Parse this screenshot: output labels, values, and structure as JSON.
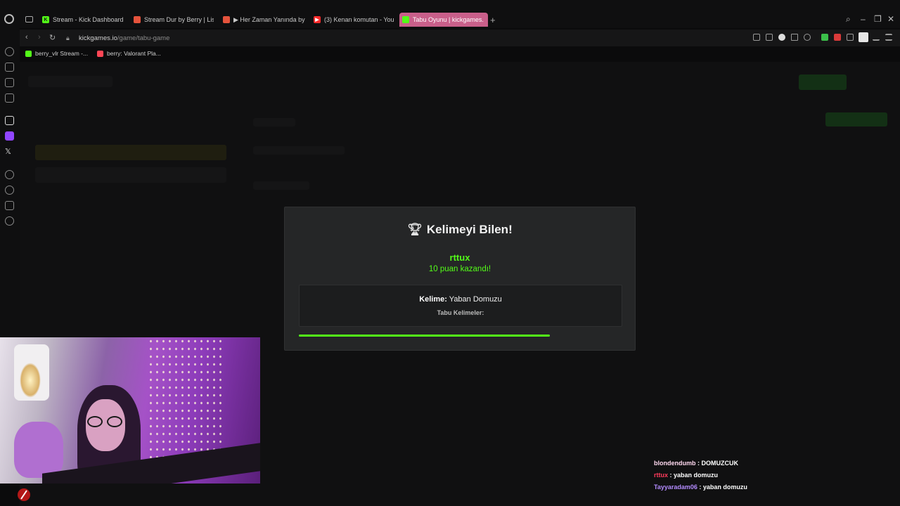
{
  "browser": {
    "tabs": [
      {
        "label": "Stream - Kick Dashboard",
        "favicon_color": "#53fc18",
        "favicon_glyph": "K",
        "active": false
      },
      {
        "label": "Stream Dur by Berry | Lis",
        "favicon_color": "#e5533c",
        "favicon_glyph": "",
        "active": false
      },
      {
        "label": "▶ Her Zaman Yanında by",
        "favicon_color": "#e5533c",
        "favicon_glyph": "",
        "active": false
      },
      {
        "label": "(3) Kenan komutan - You",
        "favicon_color": "#ff2b2b",
        "favicon_glyph": "▶",
        "active": false
      },
      {
        "label": "Tabu Oyunu | kickgames.",
        "favicon_color": "#53fc18",
        "favicon_glyph": "",
        "active": true
      }
    ],
    "new_tab_glyph": "+",
    "url_host": "kickgames.io",
    "url_path": "/game/tabu-game",
    "bookmarks": [
      {
        "label": "berry_vlr Stream -...",
        "favicon_color": "#53fc18"
      },
      {
        "label": "berry: Valorant Pla...",
        "favicon_color": "#ff4655"
      }
    ],
    "accent_color": "#c95f8a"
  },
  "modal": {
    "title": "Kelimeyi Bilen!",
    "winner": "rttux",
    "points_text": "10 puan kazandı!",
    "word_label": "Kelime:",
    "word_value": "Yaban Domuzu",
    "taboo_label": "Tabu Kelimeler:",
    "countdown_fraction": 0.777,
    "accent_color": "#53fc18"
  },
  "chat": [
    {
      "user": "blondendumb",
      "user_color": "#ffd9f0",
      "message": "DOMUZCUK"
    },
    {
      "user": "rttux",
      "user_color": "#ff3b5c",
      "message": "yaban domuzu"
    },
    {
      "user": "Tayyaradam06",
      "user_color": "#b48cff",
      "message": "yaban domuzu"
    }
  ]
}
